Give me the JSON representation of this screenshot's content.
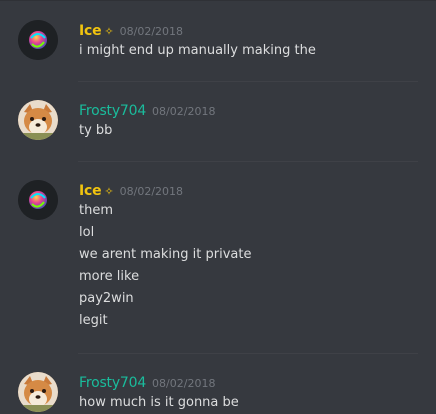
{
  "colors": {
    "background": "#36393f",
    "ice_name": "#f1c40f",
    "frosty_name": "#1abc9c",
    "timestamp": "#72767d",
    "text": "#dcddde"
  },
  "messages": [
    {
      "author": "Ice",
      "badge": "✧",
      "timestamp": "08/02/2018",
      "avatar_icon": "colorful-orb-avatar",
      "lines": [
        "i might end up manually making the"
      ]
    },
    {
      "author": "Frosty704",
      "timestamp": "08/02/2018",
      "avatar_icon": "shiba-dog-avatar",
      "lines": [
        "ty bb"
      ]
    },
    {
      "author": "Ice",
      "badge": "✧",
      "timestamp": "08/02/2018",
      "avatar_icon": "colorful-orb-avatar",
      "lines": [
        "them",
        "lol",
        "we arent making it private",
        "more like",
        "pay2win",
        "legit"
      ]
    },
    {
      "author": "Frosty704",
      "timestamp": "08/02/2018",
      "avatar_icon": "shiba-dog-avatar",
      "lines": [
        "how much is it gonna be"
      ]
    }
  ]
}
